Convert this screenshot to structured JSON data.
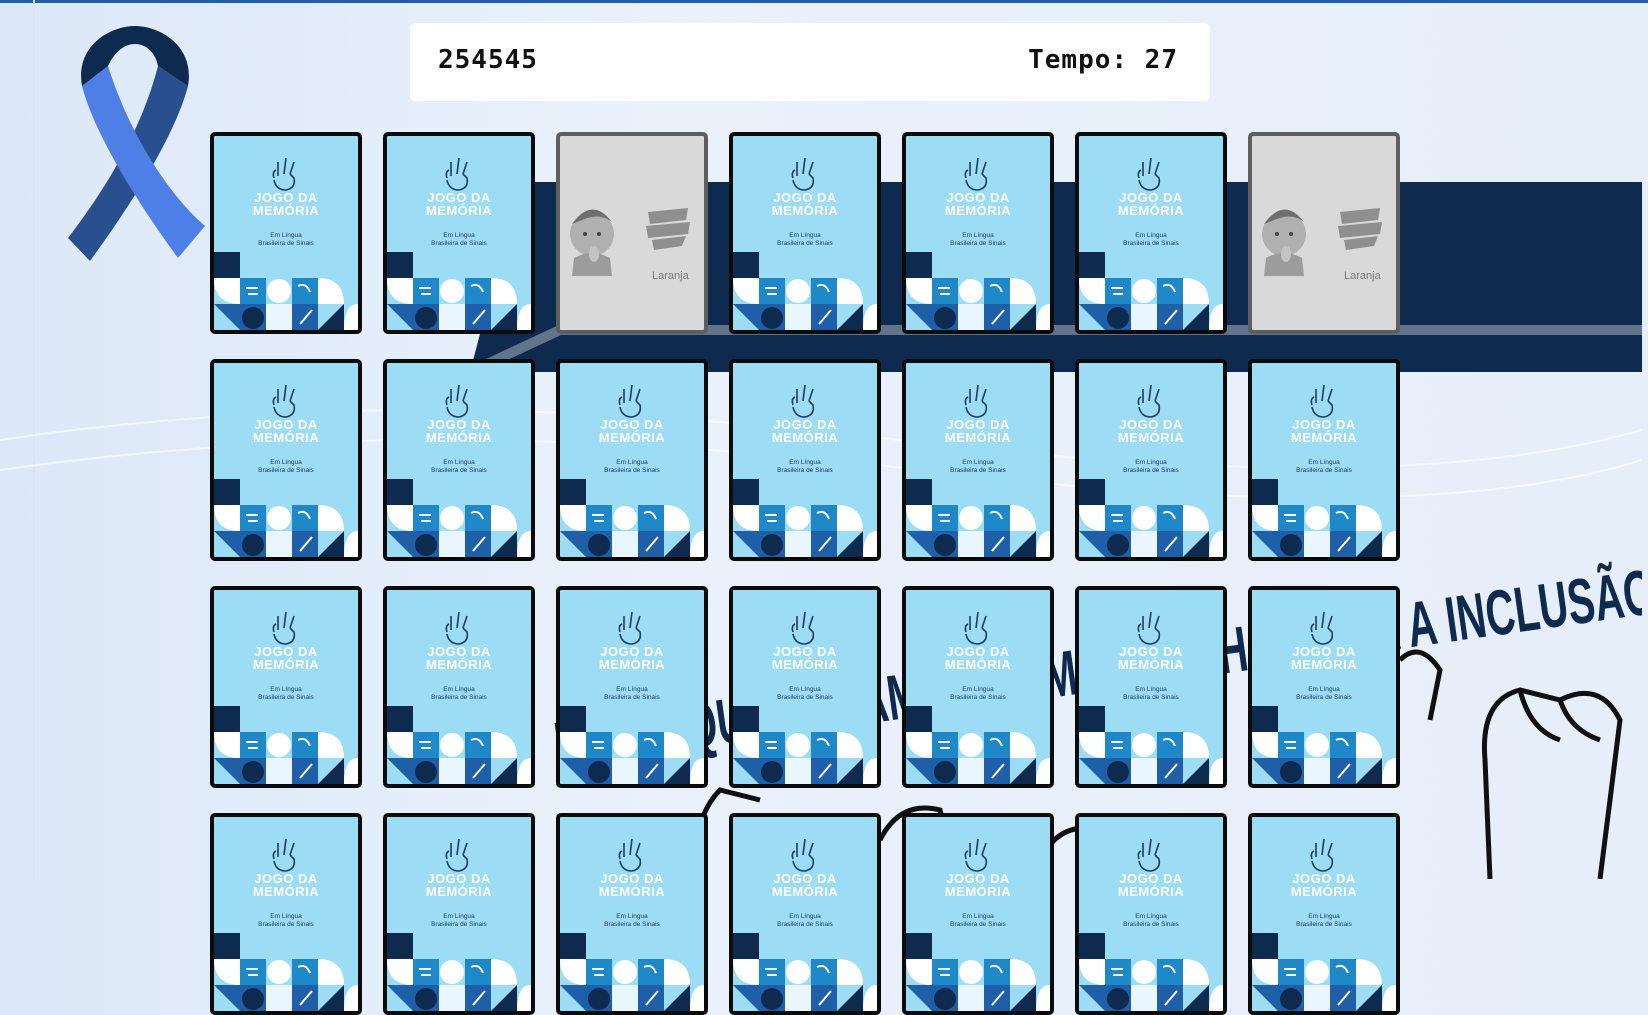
{
  "hud": {
    "score": "254545",
    "timer": "Tempo: 27"
  },
  "background": {
    "slogan": "MÃOS QUE FALAM ABREM CAMINHO PARA A INCLUSÃO"
  },
  "card_back": {
    "title_line1": "JOGO DA",
    "title_line2": "MEMÓRIA",
    "subtitle_line1": "Em Língua",
    "subtitle_line2": "Brasileira de Sinais"
  },
  "cards": [
    {
      "state": "back"
    },
    {
      "state": "back"
    },
    {
      "state": "face",
      "label": "Laranja"
    },
    {
      "state": "back"
    },
    {
      "state": "back"
    },
    {
      "state": "back"
    },
    {
      "state": "face",
      "label": "Laranja"
    },
    {
      "state": "back"
    },
    {
      "state": "back"
    },
    {
      "state": "back"
    },
    {
      "state": "back"
    },
    {
      "state": "back"
    },
    {
      "state": "back"
    },
    {
      "state": "back"
    },
    {
      "state": "back"
    },
    {
      "state": "back"
    },
    {
      "state": "back"
    },
    {
      "state": "back"
    },
    {
      "state": "back"
    },
    {
      "state": "back"
    },
    {
      "state": "back"
    },
    {
      "state": "back"
    },
    {
      "state": "back"
    },
    {
      "state": "back"
    },
    {
      "state": "back"
    },
    {
      "state": "back"
    },
    {
      "state": "back"
    },
    {
      "state": "back"
    }
  ],
  "colors": {
    "card_back": "#9ddcf5",
    "navy": "#0e2a4f",
    "accent_blue": "#1f88c9",
    "ribbon_dark": "#2a4f8f",
    "ribbon_light": "#4e7fe6"
  },
  "icons": [
    "awareness-ribbon-icon",
    "libras-hand-icon",
    "sign-language-icon",
    "hearing-impaired-icon"
  ]
}
